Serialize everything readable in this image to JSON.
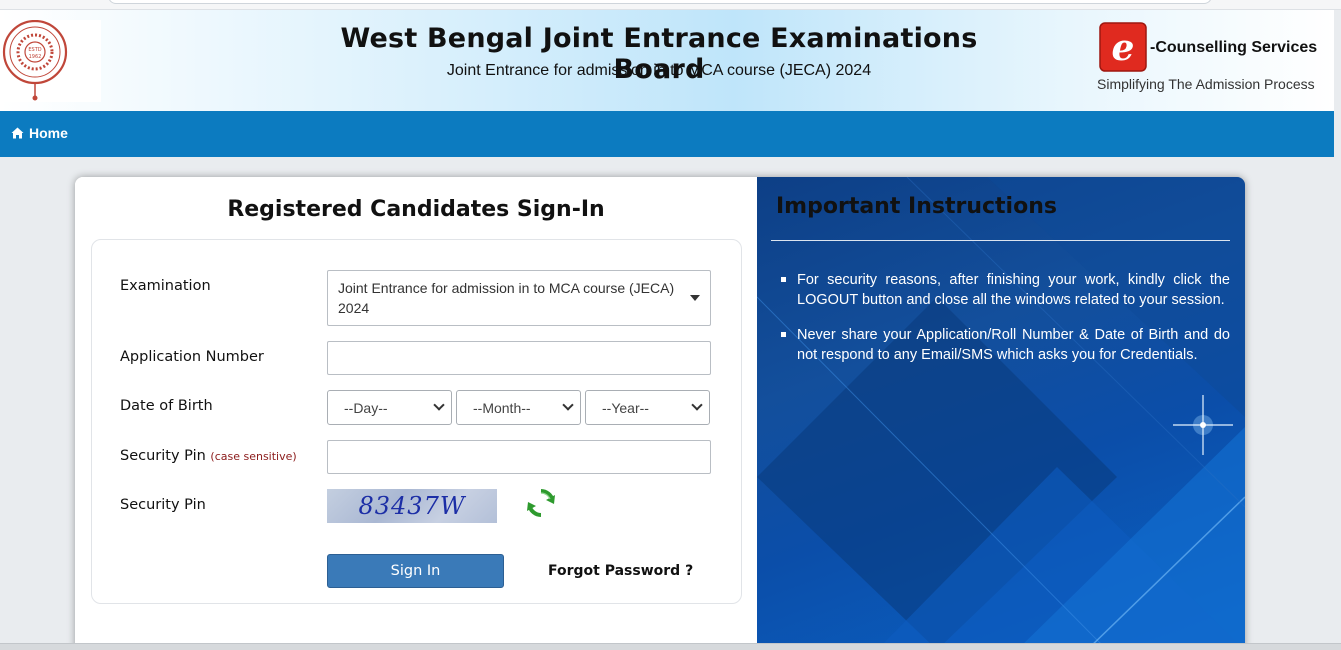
{
  "header": {
    "title": "West Bengal Joint Entrance Examinations Board",
    "subtitle": "Joint Entrance for admission in to MCA course (JECA) 2024",
    "ec_logo_letter": "e",
    "brand": "-Counselling Services",
    "tagline": "Simplifying The Admission Process"
  },
  "nav": {
    "home_label": "Home",
    "home_icon": "home-icon"
  },
  "signin": {
    "title": "Registered Candidates Sign-In",
    "examination_label": "Examination",
    "examination_value": "Joint Entrance for admission in to MCA course (JECA) 2024",
    "application_label": "Application Number",
    "application_value": "",
    "dob_label": "Date of Birth",
    "day_placeholder": "--Day--",
    "month_placeholder": "--Month--",
    "year_placeholder": "--Year--",
    "pin_input_label": "Security Pin",
    "pin_case_note": "(case sensitive)",
    "pin_input_value": "",
    "pin_display_label": "Security Pin",
    "captcha_text": "83437W",
    "signin_button": "Sign In",
    "forgot_link": "Forgot Password ?"
  },
  "instructions": {
    "title": "Important Instructions",
    "items": [
      "For security reasons, after finishing your work, kindly click the LOGOUT button and close all the windows related to your session.",
      "Never share your Application/Roll Number & Date of Birth and do not respond to any Email/SMS which asks you for Credentials."
    ]
  },
  "colors": {
    "nav_bg": "#0c7bc0",
    "signin_button": "#3a7ab8",
    "instructions_bg": "#0d3f86"
  }
}
